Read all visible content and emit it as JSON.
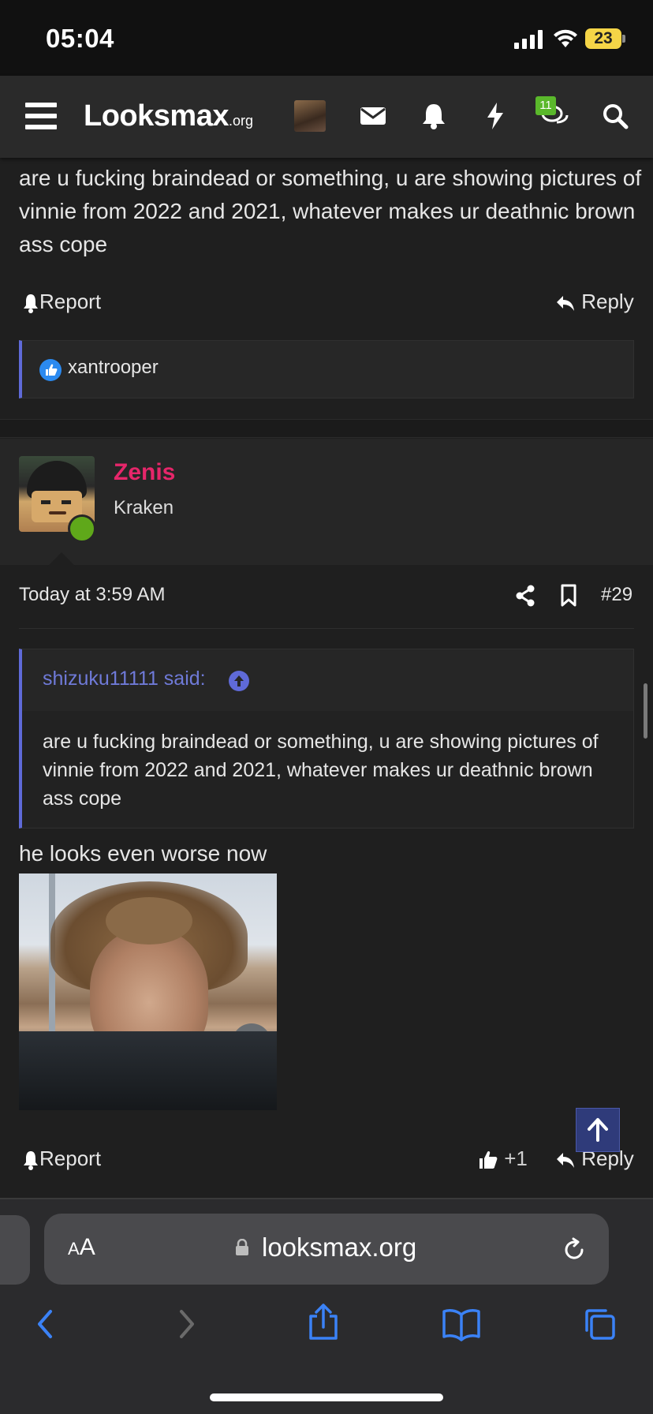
{
  "status": {
    "time": "05:04",
    "battery": "23"
  },
  "nav": {
    "logo_main": "Looksmax",
    "logo_suffix": ".org",
    "alert_badge": "11"
  },
  "previous_post": {
    "text": "are u fucking braindead or something, u are showing pictures of vinnie from 2022 and 2021, whatever makes ur deathnic brown ass cope",
    "report_label": "Report",
    "reply_label": "Reply",
    "reaction_user": "xantrooper"
  },
  "post": {
    "author": "Zenis",
    "author_title": "Kraken",
    "date": "Today at 3:59 AM",
    "number": "#29",
    "quote_author": "shizuku11111 said:",
    "quote_text": "are u fucking braindead or something, u are showing pictures of vinnie from 2022 and 2021, whatever makes ur deathnic brown ass cope",
    "message": "he looks even worse now",
    "report_label": "Report",
    "like_count": "+1",
    "reply_label": "Reply"
  },
  "browser": {
    "text_size_label_small": "A",
    "text_size_label_large": "A",
    "url": "looksmax.org"
  },
  "colors": {
    "username": "#e6266a",
    "quote_accent": "#5f6ad8",
    "online": "#5fa81a",
    "badge": "#5ab82b"
  },
  "icons": [
    "menu-icon",
    "envelope-icon",
    "bell-icon",
    "bolt-icon",
    "chat-icon",
    "search-icon",
    "share-icon",
    "bookmark-icon",
    "like-icon",
    "reply-icon",
    "arrow-up-icon",
    "back-icon",
    "forward-icon",
    "share-sheet-icon",
    "book-icon",
    "tabs-icon",
    "lock-icon",
    "reload-icon"
  ]
}
